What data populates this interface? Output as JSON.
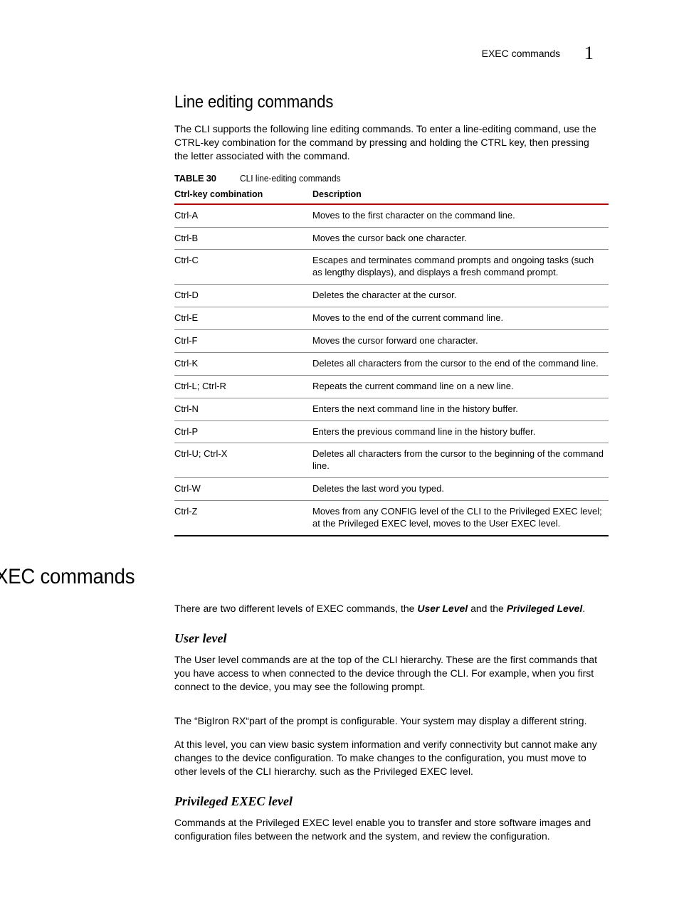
{
  "header": {
    "running_title": "EXEC commands",
    "chapter_number": "1"
  },
  "section1": {
    "title": "Line editing commands",
    "intro": "The CLI supports the following line editing commands.  To enter a line-editing command, use the CTRL-key combination for the command by pressing and holding the CTRL key, then pressing the letter associated with the command.",
    "table_label": "TABLE 30",
    "table_title": "CLI line-editing commands",
    "col1_header": "Ctrl-key combination",
    "col2_header": "Description",
    "rows": [
      {
        "key": "Ctrl-A",
        "desc": "Moves to the first character on the command line."
      },
      {
        "key": "Ctrl-B",
        "desc": "Moves the cursor back one character."
      },
      {
        "key": "Ctrl-C",
        "desc": "Escapes and terminates command prompts and ongoing tasks (such as lengthy displays), and displays a fresh command prompt."
      },
      {
        "key": "Ctrl-D",
        "desc": "Deletes the character at the cursor."
      },
      {
        "key": "Ctrl-E",
        "desc": "Moves to the end of the current command line."
      },
      {
        "key": "Ctrl-F",
        "desc": "Moves the cursor forward one character."
      },
      {
        "key": "Ctrl-K",
        "desc": "Deletes all characters from the cursor to the end of the command line."
      },
      {
        "key": "Ctrl-L; Ctrl-R",
        "desc": "Repeats the current command line on a new line."
      },
      {
        "key": "Ctrl-N",
        "desc": "Enters the next command line in the history buffer."
      },
      {
        "key": "Ctrl-P",
        "desc": "Enters the previous command line in the history buffer."
      },
      {
        "key": "Ctrl-U; Ctrl-X",
        "desc": "Deletes all characters from the cursor to the beginning of the command line."
      },
      {
        "key": "Ctrl-W",
        "desc": "Deletes the last word you typed."
      },
      {
        "key": "Ctrl-Z",
        "desc": "Moves from any CONFIG level of the CLI to the Privileged EXEC level; at the Privileged EXEC level, moves to the User EXEC level."
      }
    ]
  },
  "section2": {
    "title": "EXEC commands",
    "intro_pre": "There are two different levels of EXEC commands, the ",
    "intro_em1": "User Level",
    "intro_mid": " and the ",
    "intro_em2": "Privileged Level",
    "intro_post": ".",
    "user": {
      "title": "User level",
      "p1": "The User level commands are at the top of the CLI hierarchy. These are the first commands that you have access to when connected to the device through the CLI. For example, when you first connect to the device, you may see the following prompt.",
      "p2": "The “BigIron RX“part of the prompt is configurable. Your system may display a different string.",
      "p3": "At this level, you can view basic system information and verify connectivity but cannot make any changes to the device configuration.  To make changes to the configuration, you must move to other levels of the CLI hierarchy.  such as the Privileged EXEC level."
    },
    "priv": {
      "title": "Privileged EXEC level",
      "p1": "Commands at the Privileged EXEC level enable you to transfer and store software images and configuration files between the network and the system, and review the configuration."
    }
  }
}
